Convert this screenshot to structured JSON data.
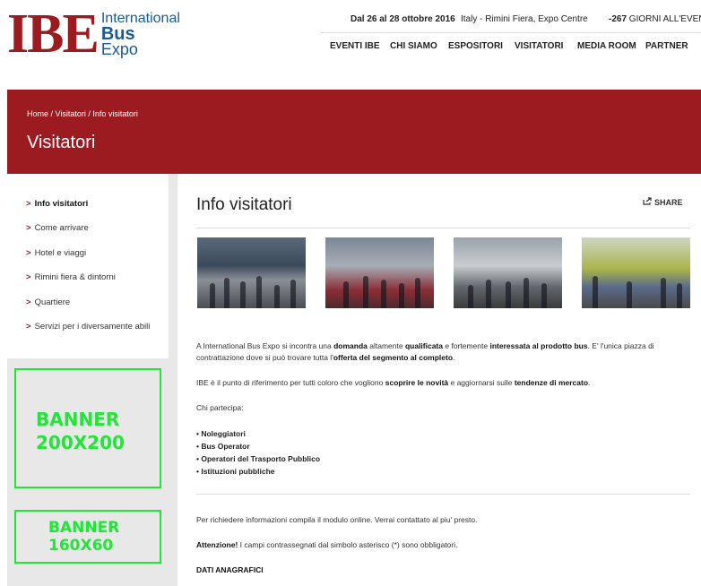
{
  "header": {
    "logo": {
      "mark": "IBE",
      "line1": "International",
      "line2": "Bus",
      "line3": "Expo"
    },
    "date": "Dal 26 al 28 ottobre 2016",
    "place": "Italy - Rimini Fiera, Expo Centre",
    "days_count": "-267",
    "days_label": "GIORNI ALL'EVENT",
    "nav": [
      "EVENTI IBE",
      "CHI SIAMO",
      "ESPOSITORI",
      "VISITATORI",
      "MEDIA ROOM",
      "PARTNER"
    ]
  },
  "band": {
    "breadcrumb": "Home / Visitatori / Info visitatori",
    "title": "Visitatori"
  },
  "sidebar": {
    "items": [
      {
        "label": "Info visitatori",
        "active": true
      },
      {
        "label": "Come arrivare",
        "active": false
      },
      {
        "label": "Hotel e viaggi",
        "active": false
      },
      {
        "label": "Rimini fiera & dintorni",
        "active": false
      },
      {
        "label": "Quartiere",
        "active": false
      },
      {
        "label": "Servizi per i diversamente abili",
        "active": false
      }
    ],
    "chevron": ">",
    "banner_big": {
      "line1": "BANNER",
      "line2": "200X200"
    },
    "banner_small": {
      "line1": "BANNER",
      "line2": "160X60"
    }
  },
  "main": {
    "title": "Info visitatori",
    "share_icon": "share-icon",
    "share_label": "SHARE",
    "para1": {
      "t1": "A  International Bus Expo si incontra una ",
      "b1": "domanda",
      "t2": " altamente ",
      "b2": "qualificata",
      "t3": " e fortemente ",
      "b3": "interessata al prodotto bus",
      "t4": ". E' l'unica piazza di contrattazione dove si può trovare tutta l'",
      "b4": "offerta del segmento al completo",
      "t5": "."
    },
    "para2": {
      "t1": "IBE è il punto di riferimento per tutti coloro che vogliono ",
      "b1": "scoprire le novità",
      "t2": " e aggiornarsi sulle ",
      "b2": "tendenze di mercato",
      "t3": "."
    },
    "participants_label": "Chi partecipa:",
    "participants": [
      "• Noleggiatori",
      "• Bus Operator",
      "• Operatori del Trasporto Pubblico",
      "• Istituzioni pubbliche"
    ],
    "form_intro": "Per richiedere informazioni compila il modulo online. Verrai contattato al piu' presto.",
    "attention_bold": "Attenzione!",
    "attention_text": " I campi contrassegnati dal simbolo asterisco (*) sono obbligatori.",
    "section_heading": "DATI ANAGRAFICI"
  },
  "colors": {
    "brand_red": "#9b1b20",
    "brand_blue": "#1c5a94",
    "banner_green": "#24e43a"
  }
}
